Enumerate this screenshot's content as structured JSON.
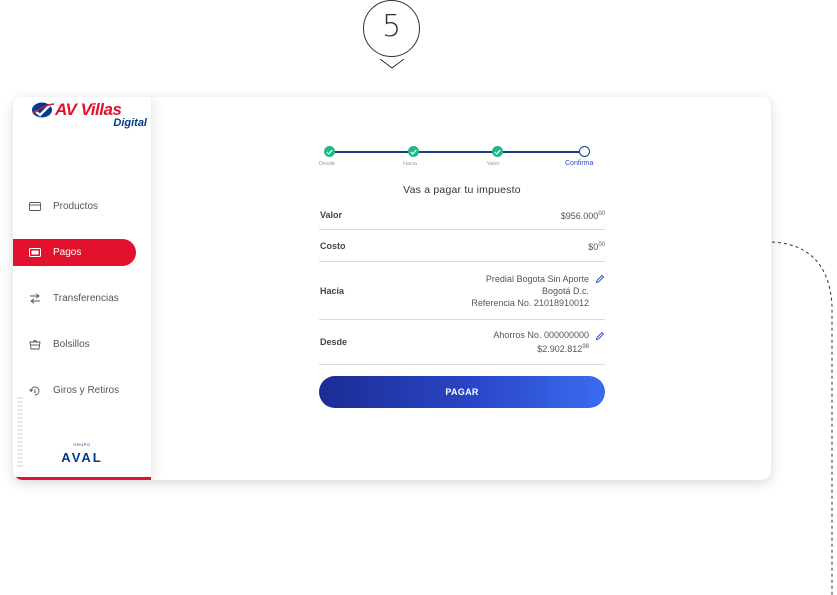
{
  "step_marker": {
    "number": "5"
  },
  "brand": {
    "name": "AV Villas",
    "sub": "Digital",
    "group_small": "GRUPO",
    "group_name": "AVAL"
  },
  "sidebar": {
    "items": [
      {
        "label": "Productos",
        "icon": "card-icon",
        "active": false
      },
      {
        "label": "Pagos",
        "icon": "bill-icon",
        "active": true
      },
      {
        "label": "Transferencias",
        "icon": "transfer-icon",
        "active": false
      },
      {
        "label": "Bolsillos",
        "icon": "pocket-icon",
        "active": false
      },
      {
        "label": "Giros y Retiros",
        "icon": "withdraw-icon",
        "active": false
      }
    ]
  },
  "stepper": {
    "steps": [
      {
        "label": "Desde",
        "state": "done"
      },
      {
        "label": "Hacia",
        "state": "done"
      },
      {
        "label": "Valor",
        "state": "done"
      },
      {
        "label": "Confirma",
        "state": "current"
      }
    ]
  },
  "summary": {
    "title": "Vas a pagar tu impuesto",
    "valor": {
      "label": "Valor",
      "amount": "$956.000",
      "cents": "00"
    },
    "costo": {
      "label": "Costo",
      "amount": "$0",
      "cents": "00"
    },
    "hacia": {
      "label": "Hacia",
      "line1": "Predial Bogota Sin Aporte",
      "line2": "Bogotá D.c.",
      "line3": "Referencia No. 21018910012"
    },
    "desde": {
      "label": "Desde",
      "line1": "Ahorros No. 000000000",
      "amount": "$2.902.812",
      "cents": "98"
    }
  },
  "pay_button": {
    "label": "PAGAR"
  },
  "colors": {
    "brand_red": "#e3112d",
    "brand_blue": "#1e3b8f",
    "success_green": "#1fb88a"
  }
}
